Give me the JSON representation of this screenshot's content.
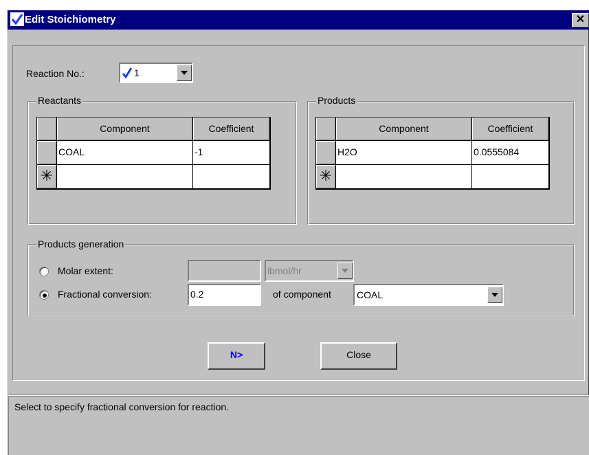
{
  "window": {
    "title": "Edit Stoichiometry",
    "close_glyph": "✕"
  },
  "reaction": {
    "label": "Reaction No.:",
    "value": "1",
    "status_icon": "checkmark-icon"
  },
  "reactants": {
    "legend": "Reactants",
    "columns": [
      "Component",
      "Coefficient"
    ],
    "rows": [
      {
        "component": "COAL",
        "coefficient": "-1"
      }
    ],
    "new_row_glyph": "✳"
  },
  "products": {
    "legend": "Products",
    "columns": [
      "Component",
      "Coefficient"
    ],
    "rows": [
      {
        "component": "H2O",
        "coefficient": "0.0555084"
      }
    ],
    "new_row_glyph": "✳"
  },
  "generation": {
    "legend": "Products generation",
    "molar_extent_label": "Molar extent:",
    "molar_extent_value": "",
    "molar_extent_unit": "lbmol/hr",
    "fractional_conversion_label": "Fractional conversion:",
    "fractional_conversion_value": "0.2",
    "of_component_label": "of component",
    "component_value": "COAL",
    "selected": "fractional_conversion"
  },
  "buttons": {
    "next_label": "N>",
    "close_label": "Close"
  },
  "status": {
    "text": "Select to specify fractional conversion for reaction."
  },
  "colors": {
    "title_bar": "#000080",
    "face": "#c0c0c0",
    "next_button_text": "#0000ff"
  }
}
